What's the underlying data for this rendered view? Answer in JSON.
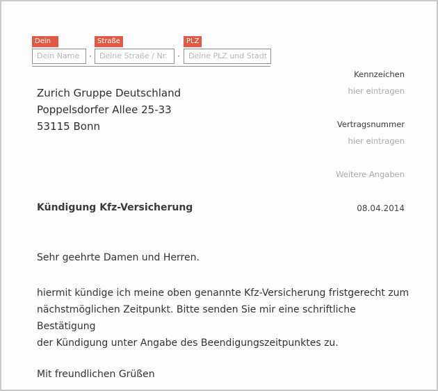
{
  "sender": {
    "name_tag": "Dein Name",
    "name_placeholder": "Dein Name",
    "street_tag": "Straße / Nr",
    "street_placeholder": "Deine Straße / Nr.",
    "city_tag": "PLZ Ort",
    "city_placeholder": "Deine PLZ und Stadt",
    "separator": "·"
  },
  "recipient": {
    "line1": "Zurich Gruppe Deutschland",
    "line2": "Poppelsdorfer Allee 25-33",
    "line3": "53115 Bonn"
  },
  "meta": {
    "kennzeichen_label": "Kennzeichen",
    "kennzeichen_hint": "hier eintragen",
    "vertrag_label": "Vertragsnummer",
    "vertrag_hint": "hier eintragen",
    "weitere": "Weitere Angaben"
  },
  "letter": {
    "subject": "Kündigung Kfz-Versicherung",
    "date": "08.04.2014",
    "salutation": "Sehr geehrte Damen und Herren.",
    "body_line1": "hiermit kündige ich meine oben genannte Kfz-Versicherung fristgerecht zum",
    "body_line2": "nächstmöglichen Zeitpunkt. Bitte senden Sie mir eine schriftliche Bestätigung",
    "body_line3": "der Kündigung unter Angabe des Beendigungszeitpunktes zu.",
    "closing": "Mit freundlichen Grüßen"
  },
  "colors": {
    "tag_bg": "#e05a47",
    "border": "#8f8f8f"
  }
}
